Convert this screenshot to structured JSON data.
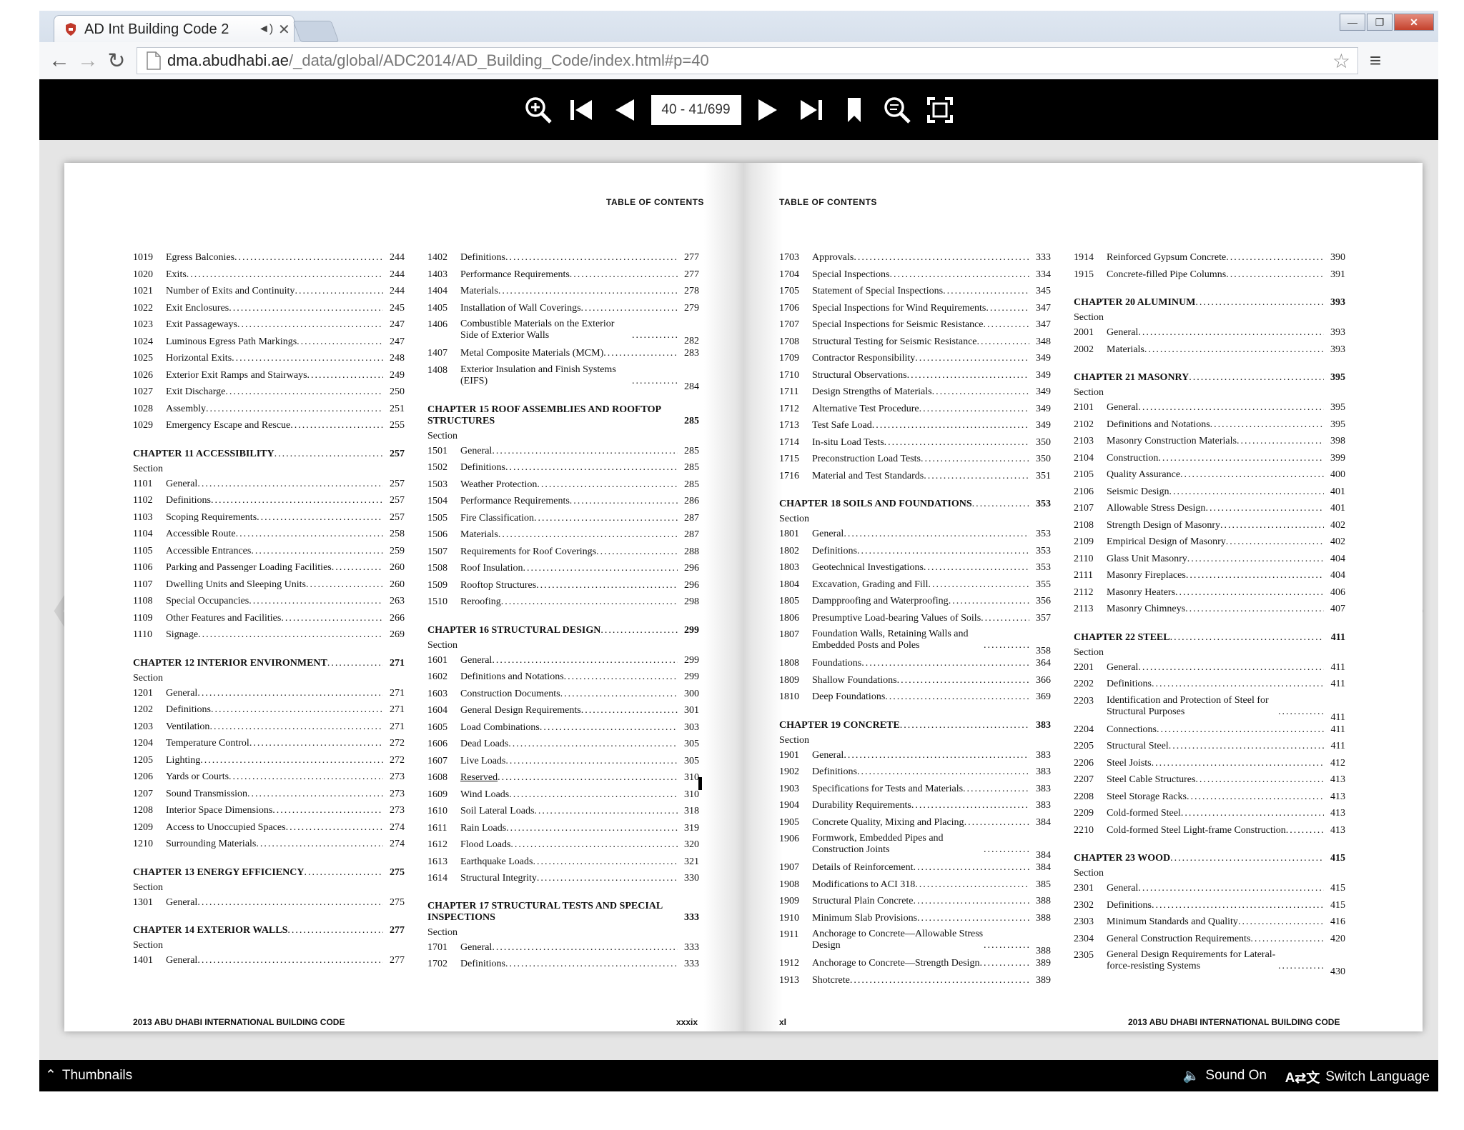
{
  "browser": {
    "tab_title": "AD Int Building Code 2",
    "url_host": "dma.abudhabi.ae",
    "url_path": "/_data/global/ADC2014/AD_Building_Code/index.html#p=40"
  },
  "viewer": {
    "page_indicator": "40 - 41/699",
    "thumbnails_label": "Thumbnails",
    "sound_label": "Sound On",
    "language_label": "Switch Language"
  },
  "left_page": {
    "running_head": "TABLE OF CONTENTS",
    "footer_title": "2013 ABU DHABI INTERNATIONAL BUILDING CODE",
    "folio": "xxxix",
    "col1": [
      {
        "s": "1019",
        "t": "Egress Balconies",
        "p": "244"
      },
      {
        "s": "1020",
        "t": "Exits",
        "p": "244"
      },
      {
        "s": "1021",
        "t": "Number of Exits and Continuity",
        "p": "244"
      },
      {
        "s": "1022",
        "t": "Exit Enclosures",
        "p": "245"
      },
      {
        "s": "1023",
        "t": "Exit Passageways",
        "p": "247"
      },
      {
        "s": "1024",
        "t": "Luminous Egress Path Markings",
        "p": "247"
      },
      {
        "s": "1025",
        "t": "Horizontal Exits",
        "p": "248"
      },
      {
        "s": "1026",
        "t": "Exterior Exit Ramps and Stairways",
        "p": "249"
      },
      {
        "s": "1027",
        "t": "Exit Discharge",
        "p": "250"
      },
      {
        "s": "1028",
        "t": "Assembly",
        "p": "251"
      },
      {
        "s": "1029",
        "t": "Emergency Escape and Rescue",
        "p": "255"
      },
      {
        "chapter": "CHAPTER 11 ACCESSIBILITY",
        "p": "257"
      },
      {
        "s": "1101",
        "t": "General",
        "p": "257"
      },
      {
        "s": "1102",
        "t": "Definitions",
        "p": "257"
      },
      {
        "s": "1103",
        "t": "Scoping Requirements",
        "p": "257"
      },
      {
        "s": "1104",
        "t": "Accessible Route",
        "p": "258"
      },
      {
        "s": "1105",
        "t": "Accessible Entrances",
        "p": "259"
      },
      {
        "s": "1106",
        "t": "Parking and Passenger Loading Facilities",
        "p": "260"
      },
      {
        "s": "1107",
        "t": "Dwelling Units and Sleeping Units",
        "p": "260"
      },
      {
        "s": "1108",
        "t": "Special Occupancies",
        "p": "263"
      },
      {
        "s": "1109",
        "t": "Other Features and Facilities",
        "p": "266"
      },
      {
        "s": "1110",
        "t": "Signage",
        "p": "269"
      },
      {
        "chapter": "CHAPTER 12 INTERIOR ENVIRONMENT",
        "p": "271"
      },
      {
        "s": "1201",
        "t": "General",
        "p": "271"
      },
      {
        "s": "1202",
        "t": "Definitions",
        "p": "271"
      },
      {
        "s": "1203",
        "t": "Ventilation",
        "p": "271"
      },
      {
        "s": "1204",
        "t": "Temperature Control",
        "p": "272"
      },
      {
        "s": "1205",
        "t": "Lighting",
        "p": "272"
      },
      {
        "s": "1206",
        "t": "Yards or Courts",
        "p": "273"
      },
      {
        "s": "1207",
        "t": "Sound Transmission",
        "p": "273"
      },
      {
        "s": "1208",
        "t": "Interior Space Dimensions",
        "p": "273"
      },
      {
        "s": "1209",
        "t": "Access to Unoccupied Spaces",
        "p": "274"
      },
      {
        "s": "1210",
        "t": "Surrounding Materials",
        "p": "274"
      },
      {
        "chapter": "CHAPTER 13 ENERGY EFFICIENCY",
        "p": "275"
      },
      {
        "s": "1301",
        "t": "General",
        "p": "275"
      },
      {
        "chapter": "CHAPTER 14 EXTERIOR WALLS",
        "p": "277"
      },
      {
        "s": "1401",
        "t": "General",
        "p": "277"
      }
    ],
    "col2": [
      {
        "s": "1402",
        "t": "Definitions",
        "p": "277"
      },
      {
        "s": "1403",
        "t": "Performance Requirements",
        "p": "277"
      },
      {
        "s": "1404",
        "t": "Materials",
        "p": "278"
      },
      {
        "s": "1405",
        "t": "Installation of Wall Coverings",
        "p": "279"
      },
      {
        "s": "1406",
        "t": "Combustible Materials on the Exterior Side of Exterior Walls",
        "p": "282",
        "two": true
      },
      {
        "s": "1407",
        "t": "Metal Composite Materials (MCM)",
        "p": "283"
      },
      {
        "s": "1408",
        "t": "Exterior Insulation and Finish Systems (EIFS)",
        "p": "284",
        "two": true
      },
      {
        "chapter": "CHAPTER 15 ROOF ASSEMBLIES AND ROOFTOP STRUCTURES",
        "p": "285",
        "two": true
      },
      {
        "s": "1501",
        "t": "General",
        "p": "285"
      },
      {
        "s": "1502",
        "t": "Definitions",
        "p": "285"
      },
      {
        "s": "1503",
        "t": "Weather Protection",
        "p": "285"
      },
      {
        "s": "1504",
        "t": "Performance Requirements",
        "p": "286"
      },
      {
        "s": "1505",
        "t": "Fire Classification",
        "p": "287"
      },
      {
        "s": "1506",
        "t": "Materials",
        "p": "287"
      },
      {
        "s": "1507",
        "t": "Requirements for Roof Coverings",
        "p": "288"
      },
      {
        "s": "1508",
        "t": "Roof Insulation",
        "p": "296"
      },
      {
        "s": "1509",
        "t": "Rooftop Structures",
        "p": "296"
      },
      {
        "s": "1510",
        "t": "Reroofing",
        "p": "298"
      },
      {
        "chapter": "CHAPTER 16 STRUCTURAL DESIGN",
        "p": "299"
      },
      {
        "s": "1601",
        "t": "General",
        "p": "299"
      },
      {
        "s": "1602",
        "t": "Definitions and Notations",
        "p": "299"
      },
      {
        "s": "1603",
        "t": "Construction Documents",
        "p": "300"
      },
      {
        "s": "1604",
        "t": "General Design Requirements",
        "p": "301"
      },
      {
        "s": "1605",
        "t": "Load Combinations",
        "p": "303"
      },
      {
        "s": "1606",
        "t": "Dead Loads",
        "p": "305"
      },
      {
        "s": "1607",
        "t": "Live Loads",
        "p": "305"
      },
      {
        "s": "1608",
        "t": "Reserved",
        "p": "310",
        "reserved": true
      },
      {
        "s": "1609",
        "t": "Wind Loads",
        "p": "310"
      },
      {
        "s": "1610",
        "t": "Soil Lateral Loads",
        "p": "318"
      },
      {
        "s": "1611",
        "t": "Rain Loads",
        "p": "319"
      },
      {
        "s": "1612",
        "t": "Flood Loads",
        "p": "320"
      },
      {
        "s": "1613",
        "t": "Earthquake Loads",
        "p": "321"
      },
      {
        "s": "1614",
        "t": "Structural Integrity",
        "p": "330"
      },
      {
        "chapter": "CHAPTER 17 STRUCTURAL TESTS AND SPECIAL INSPECTIONS",
        "p": "333",
        "two": true
      },
      {
        "s": "1701",
        "t": "General",
        "p": "333"
      },
      {
        "s": "1702",
        "t": "Definitions",
        "p": "333"
      }
    ]
  },
  "right_page": {
    "running_head": "TABLE OF CONTENTS",
    "footer_title": "2013 ABU DHABI INTERNATIONAL BUILDING CODE",
    "folio": "xl",
    "col1": [
      {
        "s": "1703",
        "t": "Approvals",
        "p": "333"
      },
      {
        "s": "1704",
        "t": "Special Inspections",
        "p": "334"
      },
      {
        "s": "1705",
        "t": "Statement of Special Inspections",
        "p": "345"
      },
      {
        "s": "1706",
        "t": "Special Inspections for Wind Requirements",
        "p": "347"
      },
      {
        "s": "1707",
        "t": "Special Inspections for Seismic Resistance",
        "p": "347"
      },
      {
        "s": "1708",
        "t": "Structural Testing for Seismic Resistance",
        "p": "348"
      },
      {
        "s": "1709",
        "t": "Contractor Responsibility",
        "p": "349"
      },
      {
        "s": "1710",
        "t": "Structural Observations",
        "p": "349"
      },
      {
        "s": "1711",
        "t": "Design Strengths of Materials",
        "p": "349"
      },
      {
        "s": "1712",
        "t": "Alternative Test Procedure",
        "p": "349"
      },
      {
        "s": "1713",
        "t": "Test Safe Load",
        "p": "349"
      },
      {
        "s": "1714",
        "t": "In-situ Load Tests",
        "p": "350"
      },
      {
        "s": "1715",
        "t": "Preconstruction Load Tests",
        "p": "350"
      },
      {
        "s": "1716",
        "t": "Material and Test Standards",
        "p": "351"
      },
      {
        "chapter": "CHAPTER 18 SOILS AND FOUNDATIONS",
        "p": "353"
      },
      {
        "s": "1801",
        "t": "General",
        "p": "353"
      },
      {
        "s": "1802",
        "t": "Definitions",
        "p": "353"
      },
      {
        "s": "1803",
        "t": "Geotechnical Investigations",
        "p": "353"
      },
      {
        "s": "1804",
        "t": "Excavation, Grading and Fill",
        "p": "355"
      },
      {
        "s": "1805",
        "t": "Dampproofing and Waterproofing",
        "p": "356"
      },
      {
        "s": "1806",
        "t": "Presumptive Load-bearing Values of Soils",
        "p": "357"
      },
      {
        "s": "1807",
        "t": "Foundation Walls, Retaining Walls and Embedded Posts and Poles",
        "p": "358",
        "two": true
      },
      {
        "s": "1808",
        "t": "Foundations",
        "p": "364"
      },
      {
        "s": "1809",
        "t": "Shallow Foundations",
        "p": "366"
      },
      {
        "s": "1810",
        "t": "Deep Foundations",
        "p": "369"
      },
      {
        "chapter": "CHAPTER 19 CONCRETE",
        "p": "383"
      },
      {
        "s": "1901",
        "t": "General",
        "p": "383"
      },
      {
        "s": "1902",
        "t": "Definitions",
        "p": "383"
      },
      {
        "s": "1903",
        "t": "Specifications for Tests and Materials",
        "p": "383"
      },
      {
        "s": "1904",
        "t": "Durability Requirements",
        "p": "383"
      },
      {
        "s": "1905",
        "t": "Concrete Quality, Mixing and Placing",
        "p": "384"
      },
      {
        "s": "1906",
        "t": "Formwork, Embedded Pipes and Construction Joints",
        "p": "384",
        "two": true
      },
      {
        "s": "1907",
        "t": "Details of Reinforcement",
        "p": "384"
      },
      {
        "s": "1908",
        "t": "Modifications to ACI 318",
        "p": "385"
      },
      {
        "s": "1909",
        "t": "Structural Plain Concrete",
        "p": "388"
      },
      {
        "s": "1910",
        "t": "Minimum Slab Provisions",
        "p": "388"
      },
      {
        "s": "1911",
        "t": "Anchorage to Concrete—Allowable Stress Design",
        "p": "388",
        "two": true
      },
      {
        "s": "1912",
        "t": "Anchorage to Concrete—Strength Design",
        "p": "389"
      },
      {
        "s": "1913",
        "t": "Shotcrete",
        "p": "389"
      }
    ],
    "col2": [
      {
        "s": "1914",
        "t": "Reinforced Gypsum Concrete",
        "p": "390"
      },
      {
        "s": "1915",
        "t": "Concrete-filled Pipe Columns",
        "p": "391"
      },
      {
        "chapter": "CHAPTER 20 ALUMINUM",
        "p": "393"
      },
      {
        "s": "2001",
        "t": "General",
        "p": "393"
      },
      {
        "s": "2002",
        "t": "Materials",
        "p": "393"
      },
      {
        "chapter": "CHAPTER 21 MASONRY",
        "p": "395"
      },
      {
        "s": "2101",
        "t": "General",
        "p": "395"
      },
      {
        "s": "2102",
        "t": "Definitions and Notations",
        "p": "395"
      },
      {
        "s": "2103",
        "t": "Masonry Construction Materials",
        "p": "398"
      },
      {
        "s": "2104",
        "t": "Construction",
        "p": "399"
      },
      {
        "s": "2105",
        "t": "Quality Assurance",
        "p": "400"
      },
      {
        "s": "2106",
        "t": "Seismic Design",
        "p": "401"
      },
      {
        "s": "2107",
        "t": "Allowable Stress Design",
        "p": "401"
      },
      {
        "s": "2108",
        "t": "Strength Design of Masonry",
        "p": "402"
      },
      {
        "s": "2109",
        "t": "Empirical Design of Masonry",
        "p": "402"
      },
      {
        "s": "2110",
        "t": "Glass Unit Masonry",
        "p": "404"
      },
      {
        "s": "2111",
        "t": "Masonry Fireplaces",
        "p": "404"
      },
      {
        "s": "2112",
        "t": "Masonry Heaters",
        "p": "406"
      },
      {
        "s": "2113",
        "t": "Masonry Chimneys",
        "p": "407"
      },
      {
        "chapter": "CHAPTER 22 STEEL",
        "p": "411"
      },
      {
        "s": "2201",
        "t": "General",
        "p": "411"
      },
      {
        "s": "2202",
        "t": "Definitions",
        "p": "411"
      },
      {
        "s": "2203",
        "t": "Identification and Protection of Steel for Structural Purposes",
        "p": "411",
        "two": true
      },
      {
        "s": "2204",
        "t": "Connections",
        "p": "411"
      },
      {
        "s": "2205",
        "t": "Structural Steel",
        "p": "411"
      },
      {
        "s": "2206",
        "t": "Steel Joists",
        "p": "412"
      },
      {
        "s": "2207",
        "t": "Steel Cable Structures",
        "p": "413"
      },
      {
        "s": "2208",
        "t": "Steel Storage Racks",
        "p": "413"
      },
      {
        "s": "2209",
        "t": "Cold-formed Steel",
        "p": "413"
      },
      {
        "s": "2210",
        "t": "Cold-formed Steel Light-frame Construction",
        "p": "413"
      },
      {
        "chapter": "CHAPTER 23 WOOD",
        "p": "415"
      },
      {
        "s": "2301",
        "t": "General",
        "p": "415"
      },
      {
        "s": "2302",
        "t": "Definitions",
        "p": "415"
      },
      {
        "s": "2303",
        "t": "Minimum Standards and Quality",
        "p": "416"
      },
      {
        "s": "2304",
        "t": "General Construction Requirements",
        "p": "420"
      },
      {
        "s": "2305",
        "t": "General Design Requirements for Lateral-force-resisting Systems",
        "p": "430",
        "two": true
      }
    ]
  },
  "section_label": "Section"
}
